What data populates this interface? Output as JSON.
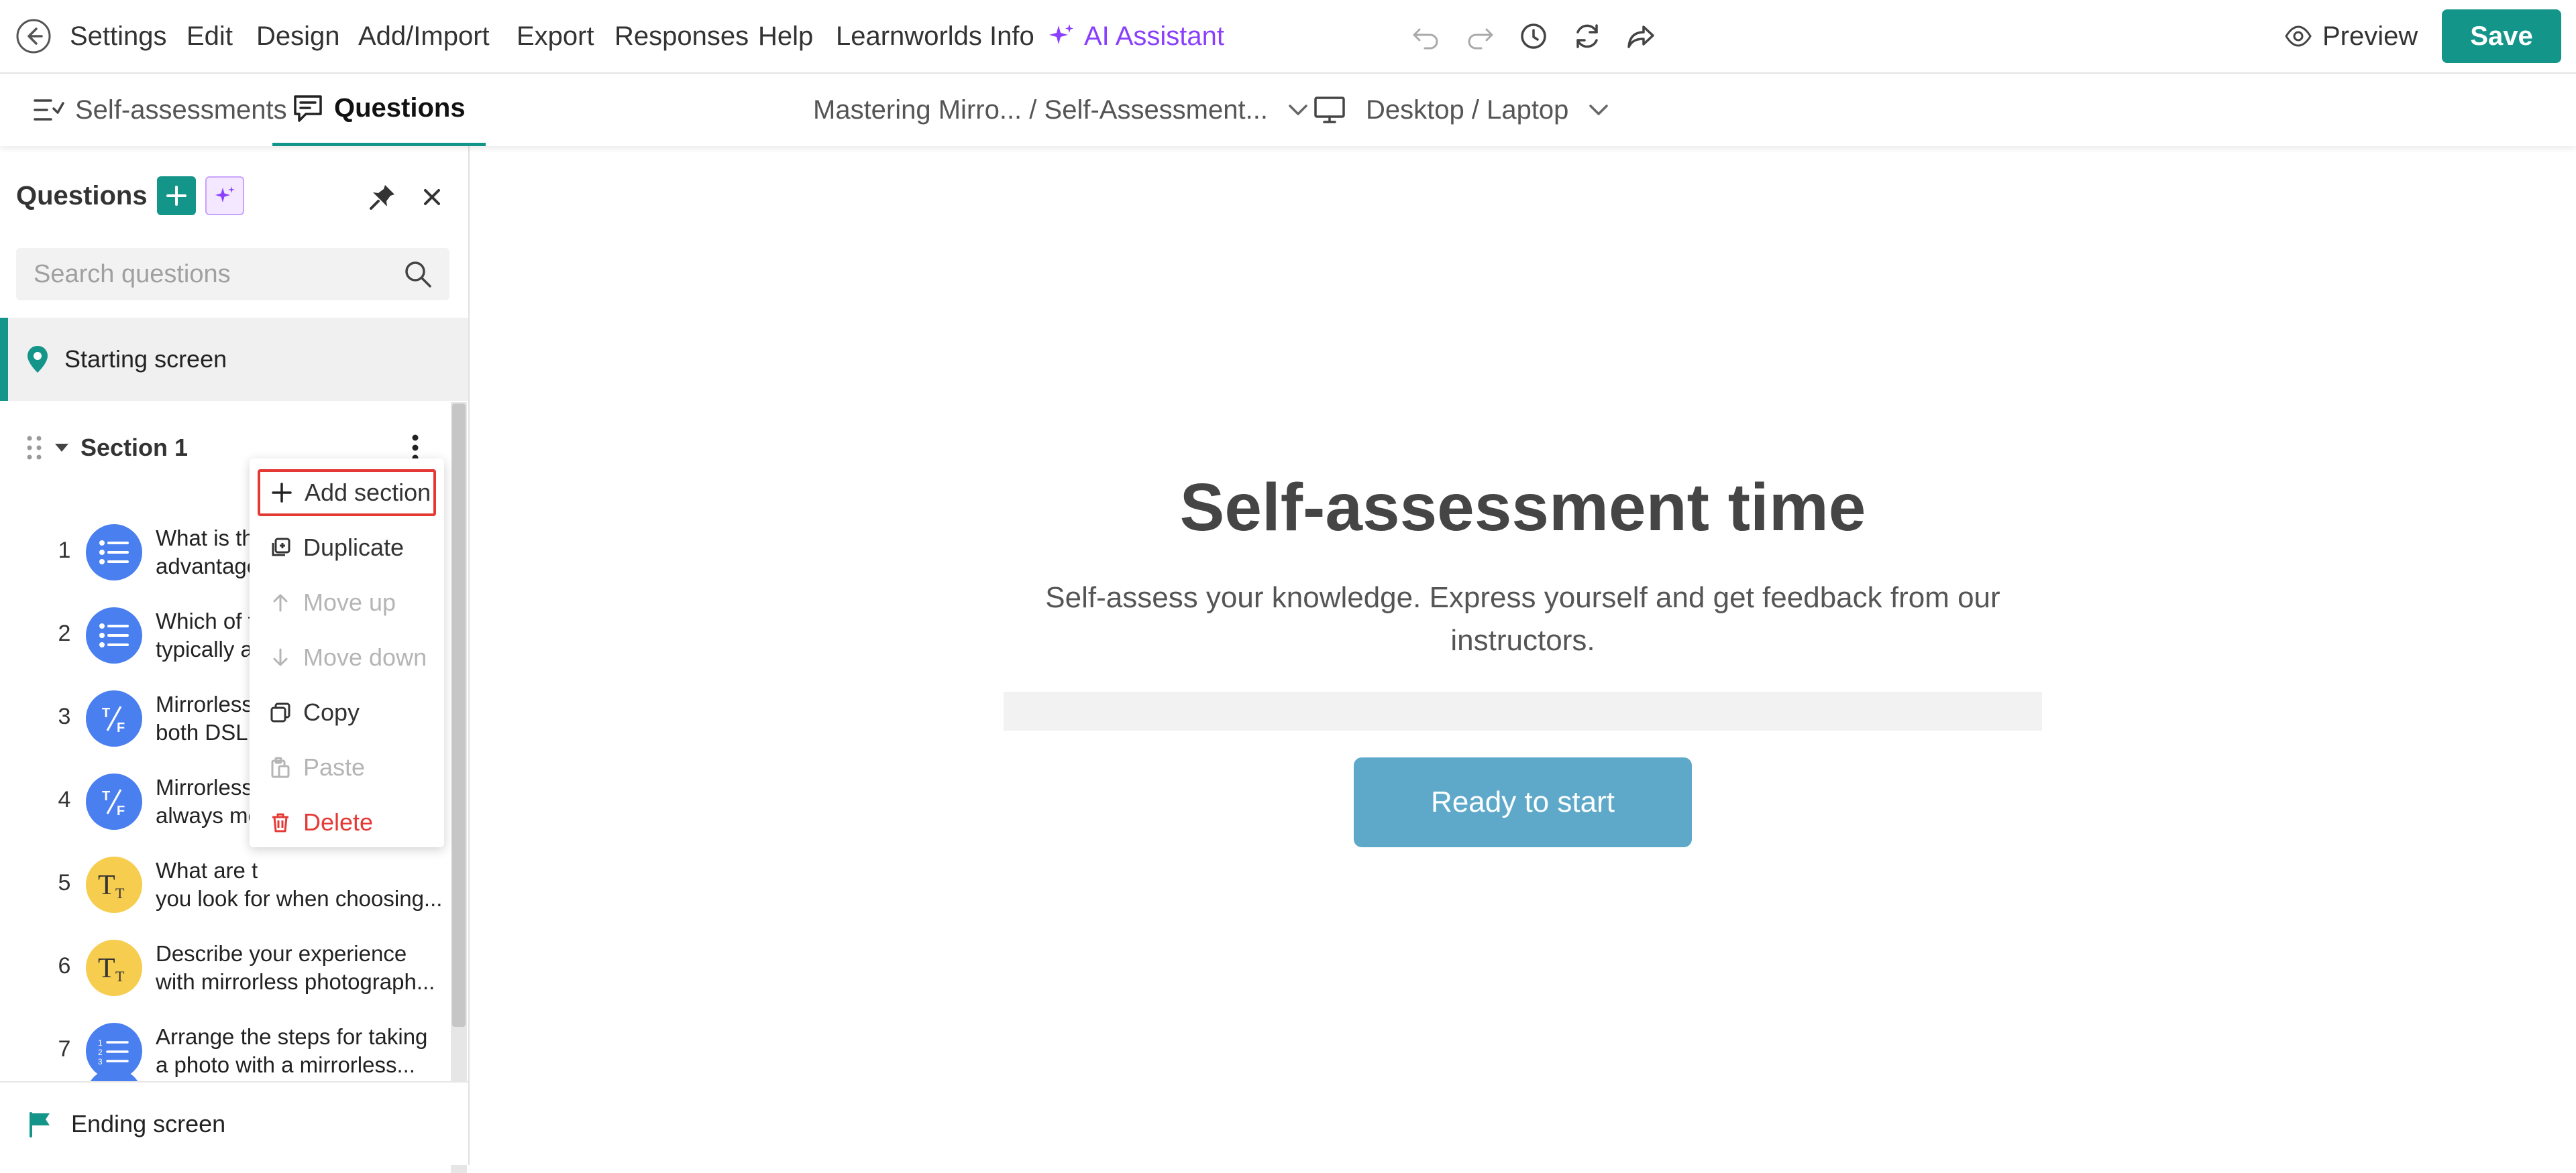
{
  "menu": {
    "items": [
      "Settings",
      "Edit",
      "Design",
      "Add/Import",
      "Export",
      "Responses",
      "Help",
      "Learnworlds Info"
    ],
    "ai_label": "AI Assistant",
    "preview_label": "Preview",
    "save_label": "Save"
  },
  "tabs": {
    "self_assessments": "Self-assessments",
    "questions": "Questions"
  },
  "breadcrumb": {
    "text": "Mastering Mirro... / Self-Assessment..."
  },
  "device": {
    "label": "Desktop / Laptop"
  },
  "sidebar": {
    "title": "Questions",
    "search_placeholder": "Search questions",
    "starting_screen": "Starting screen",
    "section_label": "Section 1",
    "ending_screen": "Ending screen",
    "questions": [
      {
        "num": "1",
        "type": "list",
        "text": "What is th\nadvantage"
      },
      {
        "num": "2",
        "type": "list",
        "text": "Which of t\ntypically a"
      },
      {
        "num": "3",
        "type": "tf",
        "text": "Mirrorless\nboth DSLR"
      },
      {
        "num": "4",
        "type": "tf",
        "text": "Mirrorless\nalways mo"
      },
      {
        "num": "5",
        "type": "text",
        "text": "What are t\nyou look for when choosing..."
      },
      {
        "num": "6",
        "type": "text",
        "text": "Describe your experience\nwith mirrorless photograph..."
      },
      {
        "num": "7",
        "type": "order",
        "text": "Arrange the steps for taking\na photo with a mirrorless..."
      }
    ]
  },
  "context_menu": {
    "add_section": "Add section",
    "duplicate": "Duplicate",
    "move_up": "Move up",
    "move_down": "Move down",
    "copy": "Copy",
    "paste": "Paste",
    "delete": "Delete"
  },
  "canvas": {
    "title": "Self-assessment time",
    "subtitle_line1": "Self-assess your knowledge. Express yourself and get feedback from our",
    "subtitle_line2": "instructors.",
    "button": "Ready to start"
  },
  "colors": {
    "accent": "#14958a",
    "ai": "#8a3ffc",
    "danger": "#e53935",
    "start_button": "#5ea9c9",
    "question_blue": "#4a7ff0",
    "question_yellow": "#f6cd4f"
  }
}
